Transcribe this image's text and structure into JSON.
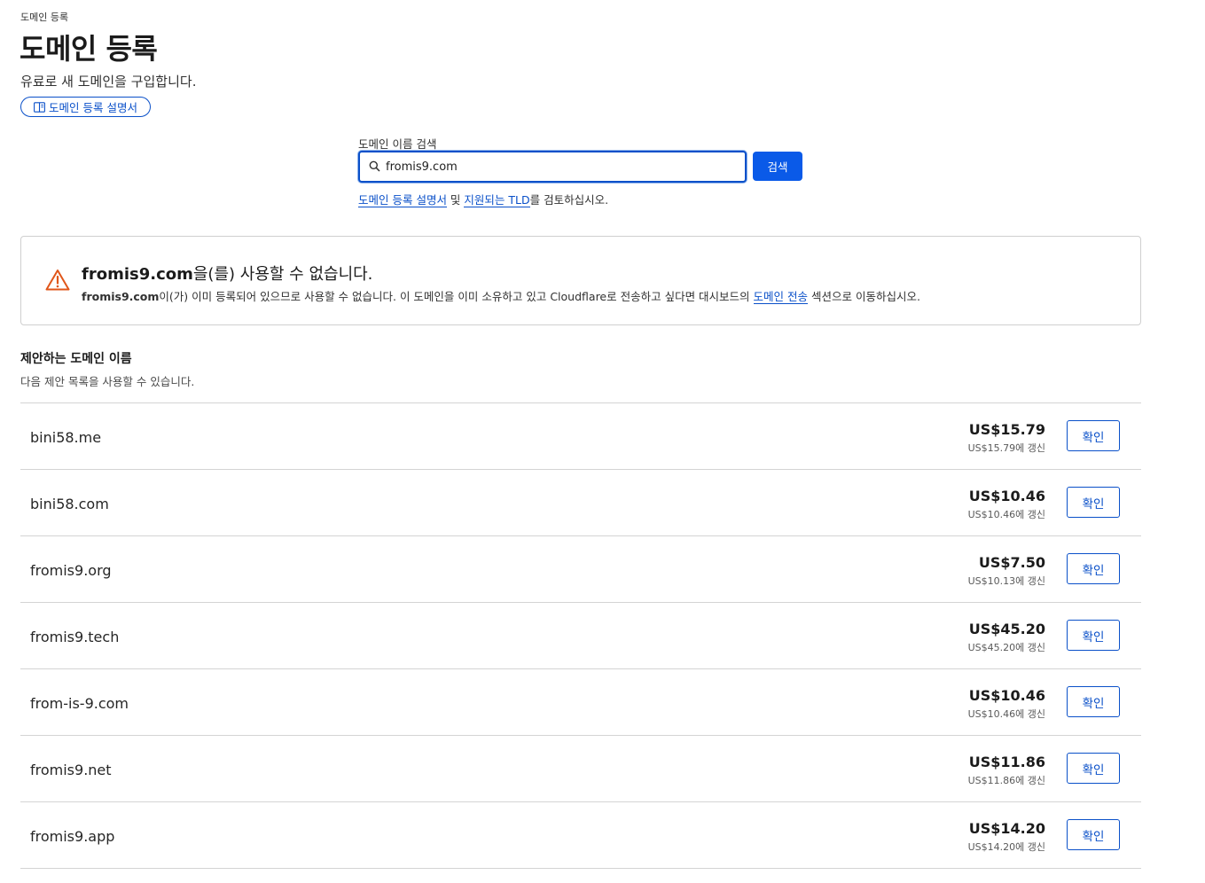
{
  "breadcrumb": "도메인 등록",
  "page": {
    "title": "도메인 등록",
    "subtitle": "유료로 새 도메인을 구입합니다.",
    "guide_button": "도메인 등록 설명서"
  },
  "search": {
    "label": "도메인 이름 검색",
    "value": "fromis9.com",
    "button": "검색",
    "hint_link1": "도메인 등록 설명서",
    "hint_and": " 및 ",
    "hint_link2": "지원되는 TLD",
    "hint_tail": "를 검토하십시오."
  },
  "alert": {
    "title_domain": "fromis9.com",
    "title_rest": "을(를) 사용할 수 없습니다.",
    "body_domain": "fromis9.com",
    "body_text": "이(가) 이미 등록되어 있으므로 사용할 수 없습니다. 이 도메인을 이미 소유하고 있고 Cloudflare로 전송하고 싶다면 대시보드의 ",
    "body_link": "도메인 전송",
    "body_tail": " 섹션으로 이동하십시오.",
    "icon": "warning-icon",
    "icon_color": "#e0561a"
  },
  "suggestions": {
    "title": "제안하는 도메인 이름",
    "subtitle": "다음 제안 목록을 사용할 수 있습니다.",
    "button_label": "확인",
    "items": [
      {
        "name": "bini58.me",
        "price": "US$15.79",
        "renew": "US$15.79에 갱신"
      },
      {
        "name": "bini58.com",
        "price": "US$10.46",
        "renew": "US$10.46에 갱신"
      },
      {
        "name": "fromis9.org",
        "price": "US$7.50",
        "renew": "US$10.13에 갱신"
      },
      {
        "name": "fromis9.tech",
        "price": "US$45.20",
        "renew": "US$45.20에 갱신"
      },
      {
        "name": "from-is-9.com",
        "price": "US$10.46",
        "renew": "US$10.46에 갱신"
      },
      {
        "name": "fromis9.net",
        "price": "US$11.86",
        "renew": "US$11.86에 갱신"
      },
      {
        "name": "fromis9.app",
        "price": "US$14.20",
        "renew": "US$14.20에 갱신"
      }
    ]
  },
  "colors": {
    "accent": "#0a50c9",
    "primary_button": "#0a5ae8",
    "warning": "#e0561a"
  }
}
